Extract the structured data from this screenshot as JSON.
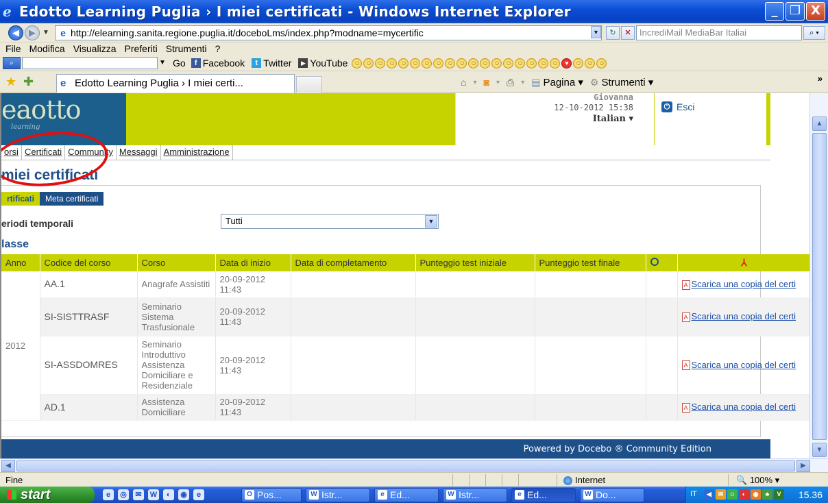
{
  "window": {
    "title": "Edotto Learning Puglia › I miei certificati - Windows Internet Explorer",
    "minimize": "_",
    "maximize": "❐",
    "close": "X"
  },
  "address": {
    "url": "http://elearning.sanita.regione.puglia.it/doceboLms/index.php?modname=mycertific",
    "search_placeholder": "IncrediMail MediaBar Italiai"
  },
  "menu": [
    "File",
    "Modifica",
    "Visualizza",
    "Preferiti",
    "Strumenti",
    "?"
  ],
  "toolbar": {
    "go": "Go",
    "facebook": "Facebook",
    "twitter": "Twitter",
    "youtube": "YouTube"
  },
  "tabbar": {
    "tab_title": "Edotto Learning Puglia › I miei certi...",
    "pagina": "Pagina ▾",
    "strumenti": "Strumenti ▾"
  },
  "site": {
    "logo": "eaotto",
    "logo_sub": "learning",
    "user_name": "Giovanna",
    "datetime": "12-10-2012 15:38",
    "language": "Italian ▾",
    "logout": "Esci",
    "nav": [
      "orsi",
      "Certificati",
      "Community",
      "Messaggi",
      "Amministrazione"
    ],
    "page_title": "miei certificati",
    "subtabs": [
      "rtificati",
      "Meta certificati"
    ],
    "periodi_label": "eriodi temporali",
    "periodi_value": "Tutti",
    "classe": "lasse",
    "footer": "Powered by Docebo ® Community Edition"
  },
  "table": {
    "headers": [
      "Anno",
      "Codice del corso",
      "Corso",
      "Data di inizio",
      "Data di completamento",
      "Punteggio test iniziale",
      "Punteggio test finale"
    ],
    "year": "2012",
    "download_label": "Scarica una copia del certi",
    "rows": [
      {
        "codice": "AA.1",
        "corso": "Anagrafe Assistiti",
        "data_inizio": "20-09-2012 11:43"
      },
      {
        "codice": "SI-SISTTRASF",
        "corso": "Seminario Sistema Trasfusionale",
        "data_inizio": "20-09-2012 11:43"
      },
      {
        "codice": "SI-ASSDOMRES",
        "corso": "Seminario Introduttivo Assistenza Domiciliare e Residenziale",
        "data_inizio": "20-09-2012 11:43"
      },
      {
        "codice": "AD.1",
        "corso": "Assistenza Domiciliare",
        "data_inizio": "20-09-2012 11:43"
      }
    ]
  },
  "statusbar": {
    "status": "Fine",
    "zone": "Internet",
    "zoom": "100%"
  },
  "taskbar": {
    "start": "start",
    "tasks": [
      "Pos...",
      "Istr...",
      "Ed...",
      "Istr...",
      "Ed...",
      "Do..."
    ],
    "lang": "IT",
    "clock": "15.36"
  }
}
